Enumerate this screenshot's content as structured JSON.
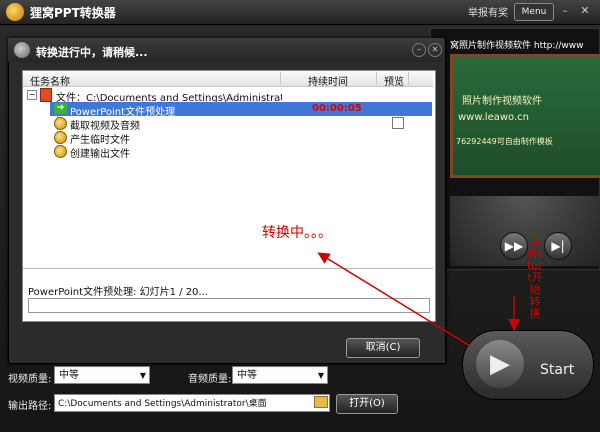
{
  "app": {
    "title": "狸窝PPT转换器",
    "report_link": "举报有奖",
    "menu_label": "Menu",
    "minimize_glyph": "–",
    "close_glyph": "✕"
  },
  "preview": {
    "marquee": "窝照片制作视频软件 http://www",
    "board_line1": "照片制作视频软件",
    "board_line2": "www.leawo.cn",
    "board_line3": "76292449可自由制作模板",
    "ff_glyph": "▶▶",
    "next_glyph": "▶|"
  },
  "start": {
    "label": "Start",
    "glyph": "▶"
  },
  "settings": {
    "video_quality_label": "视频质量:",
    "video_quality_value": "中等",
    "audio_quality_label": "音频质量:",
    "audio_quality_value": "中等",
    "output_label": "输出路径:",
    "output_value": "C:\\Documents and Settings\\Administrator\\桌面",
    "open_button": "打开(O)"
  },
  "dialog": {
    "title": "转换进行中，请稍候...",
    "columns": {
      "name": "任务名称",
      "duration": "持续时间",
      "preview": "预览"
    },
    "tree_toggle": "−",
    "file_row": "文件：C:\\Documents and Settings\\Administrator\\桌面\\...",
    "steps": [
      {
        "label": "PowerPoint文件预处理",
        "time": "00:00:05"
      },
      {
        "label": "截取视频及音频"
      },
      {
        "label": "产生临时文件"
      },
      {
        "label": "创建输出文件"
      }
    ],
    "converting_text": "转换中。。。",
    "status_text": "PowerPoint文件预处理: 幻灯片1 / 20...",
    "progress": 0,
    "cancel_button": "取消(C)",
    "minimize_glyph": "–",
    "close_glyph": "✕",
    "arrow_glyph": "➜"
  },
  "annotation": {
    "vertical_text": "点击start开始转换",
    "color": "#d00000"
  }
}
